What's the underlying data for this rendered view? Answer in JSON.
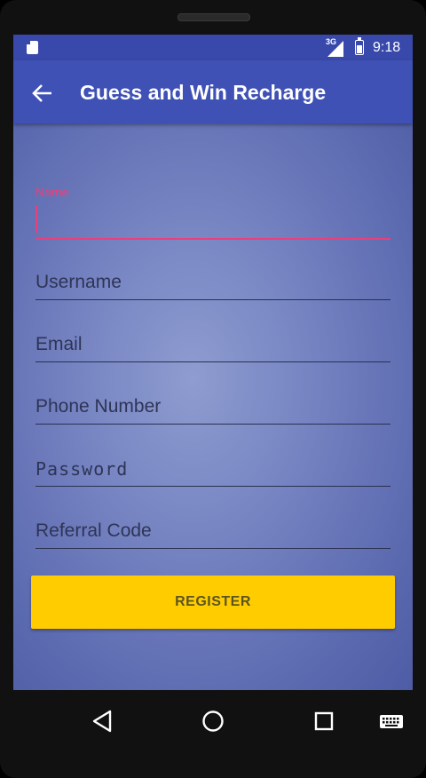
{
  "status_bar": {
    "network": "3G",
    "time": "9:18"
  },
  "app_bar": {
    "title": "Guess and Win Recharge",
    "back_icon": "arrow-back-icon"
  },
  "form": {
    "name": {
      "label": "Name",
      "value": ""
    },
    "username": {
      "placeholder": "Username"
    },
    "email": {
      "placeholder": "Email"
    },
    "phone": {
      "placeholder": "Phone Number"
    },
    "password": {
      "placeholder": "Password"
    },
    "referral": {
      "placeholder": "Referral Code"
    },
    "register_label": "REGISTER"
  },
  "nav_bar": {
    "back": "nav-back-icon",
    "home": "nav-home-icon",
    "recents": "nav-recents-icon",
    "keyboard": "keyboard-icon"
  },
  "colors": {
    "app_bar": "#3f51b5",
    "status_bar": "#3949ab",
    "accent": "#e8407c",
    "button": "#ffcc00"
  }
}
